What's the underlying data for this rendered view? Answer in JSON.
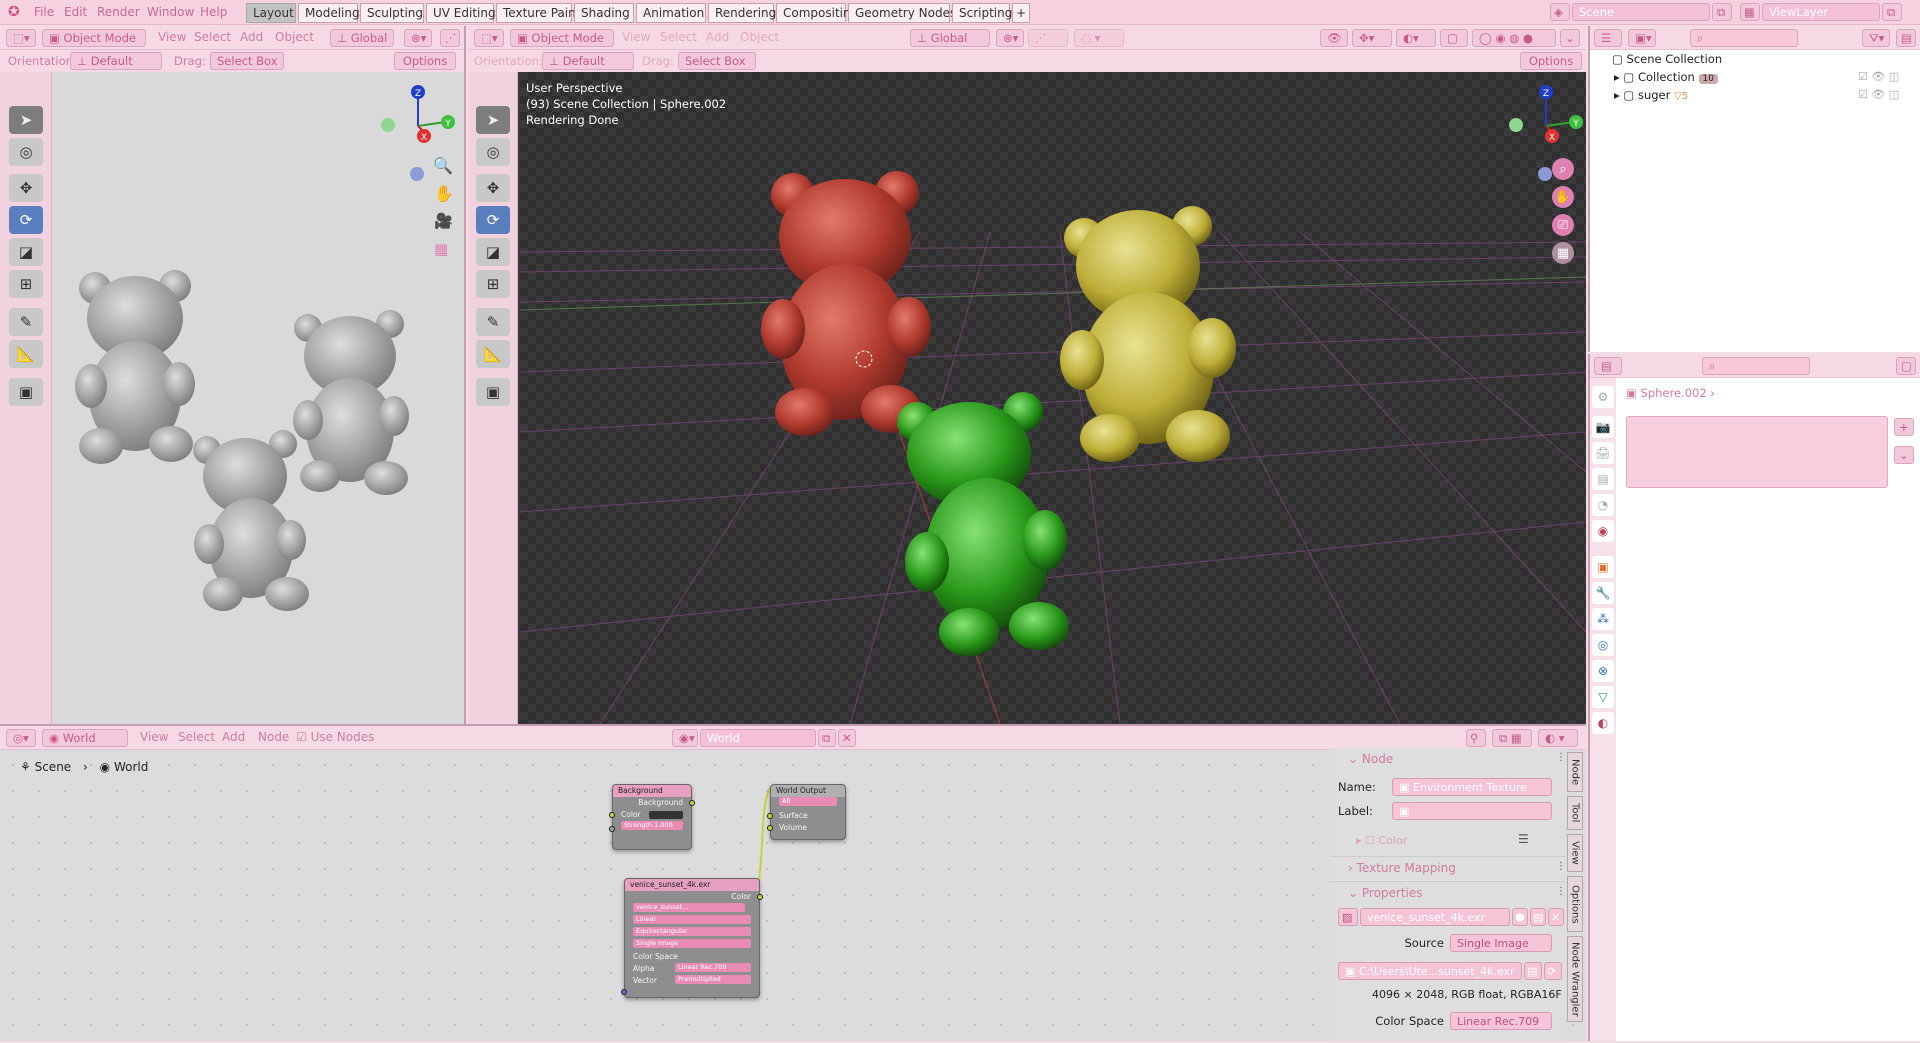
{
  "menus": [
    "File",
    "Edit",
    "Render",
    "Window",
    "Help"
  ],
  "workspaces": [
    "Layout",
    "Modeling",
    "Sculpting",
    "UV Editing",
    "Texture Paint",
    "Shading",
    "Animation",
    "Rendering",
    "Compositing",
    "Geometry Nodes",
    "Scripting"
  ],
  "add_tab": "+",
  "scene_name": "Scene",
  "view_layer": "ViewLayer",
  "left_view": {
    "mode": "Object Mode",
    "menus": [
      "View",
      "Select",
      "Add",
      "Object"
    ],
    "transform": "Global",
    "orientation_label": "Orientation:",
    "orientation": "Default",
    "drag_label": "Drag:",
    "drag": "Select Box",
    "options": "Options"
  },
  "main_view": {
    "mode": "Object Mode",
    "menus": [
      "View",
      "Select",
      "Add",
      "Object"
    ],
    "transform": "Global",
    "orientation_label": "Orientation:",
    "orientation": "Default",
    "drag_label": "Drag:",
    "drag": "Select Box",
    "options": "Options",
    "overlay_line1": "User Perspective",
    "overlay_line2": "(93) Scene Collection | Sphere.002",
    "overlay_line3": "Rendering Done"
  },
  "gizmo": {
    "z": "Z",
    "y": "Y",
    "x": "X"
  },
  "outliner": {
    "root": "Scene Collection",
    "items": [
      {
        "name": "Collection",
        "badge": "10"
      },
      {
        "name": "suger",
        "badge": "5"
      }
    ]
  },
  "properties": {
    "object_name": "Sphere.002"
  },
  "node_editor": {
    "type": "World",
    "menus": [
      "View",
      "Select",
      "Add",
      "Node"
    ],
    "use_nodes": "Use Nodes",
    "world_selector": "World",
    "breadcrumb_scene": "Scene",
    "breadcrumb_world": "World",
    "bg_node": {
      "title": "Background",
      "out": "Background",
      "color": "Color",
      "strength": "Strength   1.000"
    },
    "out_node": {
      "title": "World Output",
      "target": "All",
      "surface": "Surface",
      "volume": "Volume"
    },
    "env_node": {
      "title": "venice_sunset_4k.exr",
      "out": "Color",
      "img": "venice_sunset...",
      "interp": "Linear",
      "proj": "Equirectangular",
      "src": "Single Image",
      "cs_label": "Color Space",
      "cs": "Linear Rec.709",
      "alpha_label": "Alpha",
      "alpha": "Premultiplied",
      "vector": "Vector"
    }
  },
  "sidebar": {
    "node_hd": "Node",
    "name_label": "Name:",
    "name_val": "Environment Texture",
    "label_label": "Label:",
    "label_val": "",
    "color": "Color",
    "tex_mapping": "Texture Mapping",
    "props_hd": "Properties",
    "image_name": "venice_sunset_4k.exr",
    "source_label": "Source",
    "source_val": "Single Image",
    "filepath": "C:\\Users\\Ute...sunset_4k.exr",
    "info": "4096 × 2048,  RGB float,  RGBA16F",
    "colorspace_label": "Color Space",
    "colorspace_val": "Linear Rec.709"
  },
  "side_tabs": [
    "Node",
    "Tool",
    "View",
    "Options",
    "Node Wrangler"
  ]
}
